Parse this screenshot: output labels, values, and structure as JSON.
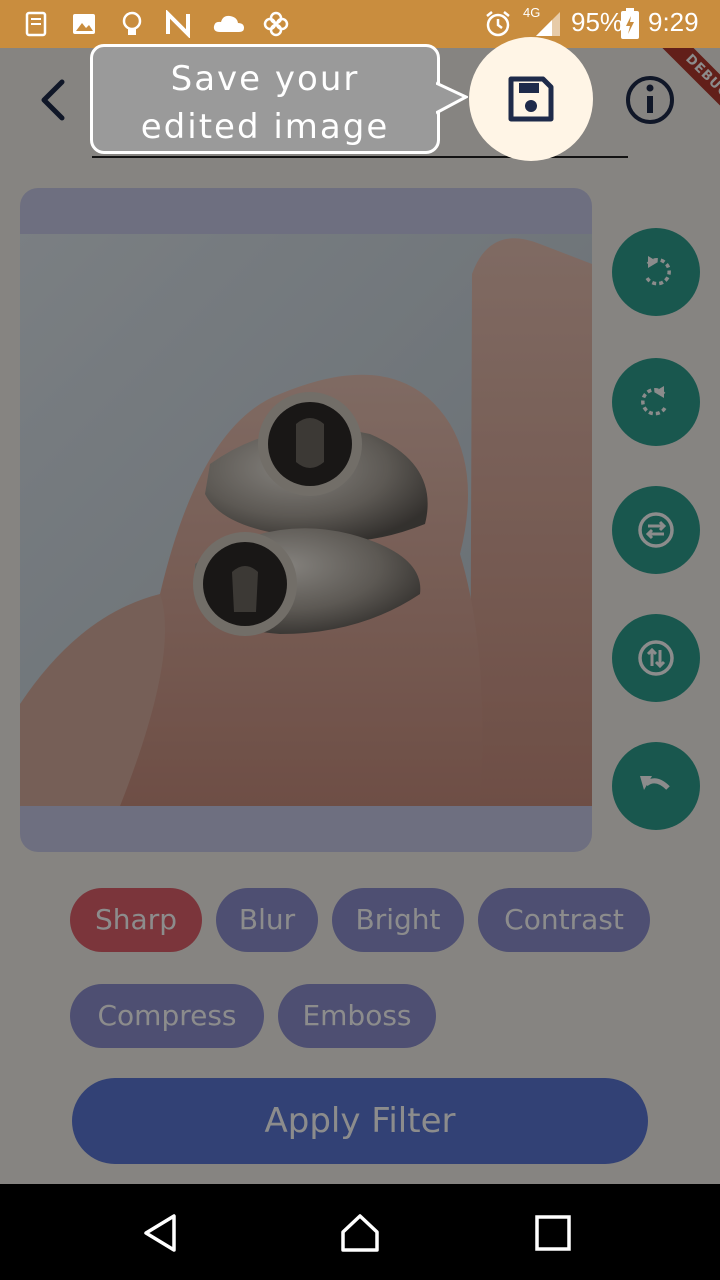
{
  "status_bar": {
    "network": "4G",
    "battery": "95%",
    "time": "9:29",
    "icons": [
      "notebook-icon",
      "image-icon",
      "lightbulb-icon",
      "n-app-icon",
      "cloud-icon",
      "pinwheel-icon",
      "alarm-icon",
      "signal-icon",
      "battery-icon"
    ],
    "color": "#c98d3e"
  },
  "header": {
    "back_icon": "back-chevron-icon",
    "save_icon": "save-icon",
    "info_icon": "info-icon",
    "debug_banner": "DEBUG"
  },
  "tooltip": {
    "text": "Save your edited image"
  },
  "image": {
    "description_icon": "ring-photo"
  },
  "side_actions": [
    {
      "name": "rotate-left-icon"
    },
    {
      "name": "rotate-right-icon"
    },
    {
      "name": "flip-horizontal-icon"
    },
    {
      "name": "flip-vertical-icon"
    },
    {
      "name": "undo-icon"
    }
  ],
  "filters": [
    {
      "label": "Sharp",
      "active": true
    },
    {
      "label": "Blur",
      "active": false
    },
    {
      "label": "Bright",
      "active": false
    },
    {
      "label": "Contrast",
      "active": false
    },
    {
      "label": "Compress",
      "active": false
    },
    {
      "label": "Emboss",
      "active": false
    }
  ],
  "apply_button": {
    "label": "Apply Filter"
  },
  "colors": {
    "accent_teal": "#2f9e8f",
    "chip_active": "#e0616c",
    "chip_inactive": "#8e90cf",
    "apply": "#5c77d6"
  },
  "nav_bar": {
    "icons": [
      "nav-back-icon",
      "nav-home-icon",
      "nav-recents-icon"
    ]
  }
}
